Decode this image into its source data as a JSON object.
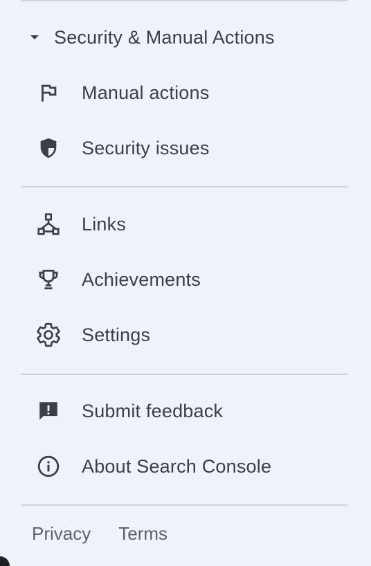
{
  "section": {
    "title": "Security & Manual Actions",
    "caret_icon": "arrow-drop-down-icon"
  },
  "items_group1": [
    {
      "label": "Manual actions",
      "icon": "flag-icon"
    },
    {
      "label": "Security issues",
      "icon": "shield-icon"
    }
  ],
  "items_group2": [
    {
      "label": "Links",
      "icon": "links-sitemap-icon"
    },
    {
      "label": "Achievements",
      "icon": "trophy-icon"
    },
    {
      "label": "Settings",
      "icon": "gear-icon"
    }
  ],
  "items_group3": [
    {
      "label": "Submit feedback",
      "icon": "feedback-icon"
    },
    {
      "label": "About Search Console",
      "icon": "info-icon"
    }
  ],
  "footer": {
    "privacy": "Privacy",
    "terms": "Terms"
  },
  "colors": {
    "background": "#eef2f9",
    "text": "#3c4043",
    "footer_text": "#5f6368",
    "divider": "#cfd3d8",
    "icon": "#3c4043"
  }
}
